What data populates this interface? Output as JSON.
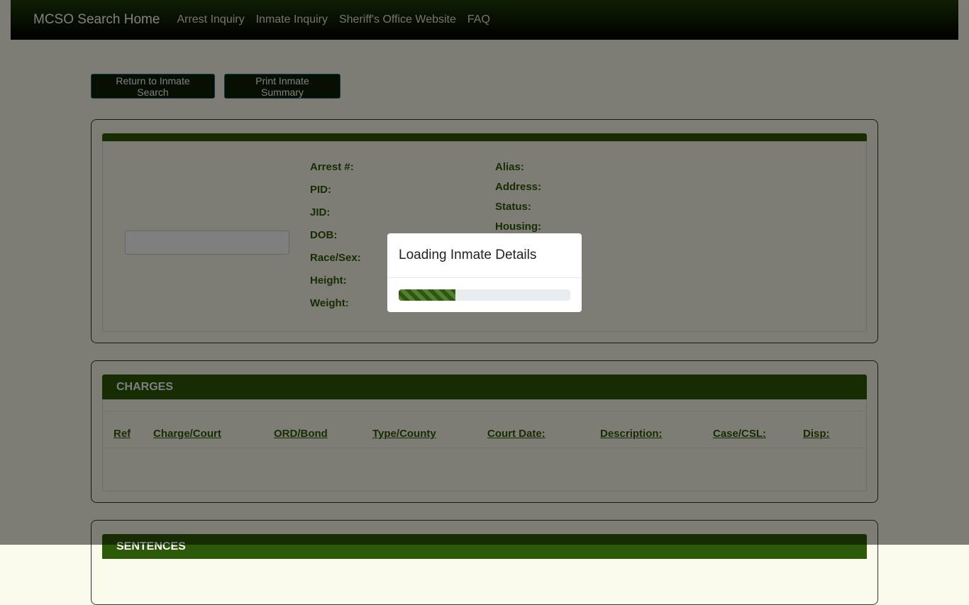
{
  "nav": {
    "brand": "MCSO Search Home",
    "links": [
      "Arrest Inquiry",
      "Inmate Inquiry",
      "Sheriff's Office Website",
      "FAQ"
    ]
  },
  "actions": {
    "return_label": "Return to Inmate Search",
    "print_label": "Print Inmate Summary"
  },
  "details": {
    "left_labels": [
      "Arrest #:",
      "PID:",
      "JID:",
      "DOB:",
      "Race/Sex:",
      "Height:",
      "Weight:"
    ],
    "right_labels": [
      "Alias:",
      "Address:",
      "Status:",
      "Housing:"
    ]
  },
  "charges": {
    "title": "CHARGES",
    "columns": [
      "Ref",
      "Charge/Court",
      "ORD/Bond",
      "Type/County",
      "Court Date:",
      "Description:",
      "Case/CSL:",
      "Disp:"
    ]
  },
  "sentences": {
    "title": "SENTENCES"
  },
  "modal": {
    "title": "Loading Inmate Details",
    "progress_percent": 33
  },
  "colors": {
    "accent": "#2d5a08",
    "nav_dark": "#0c1f05"
  }
}
